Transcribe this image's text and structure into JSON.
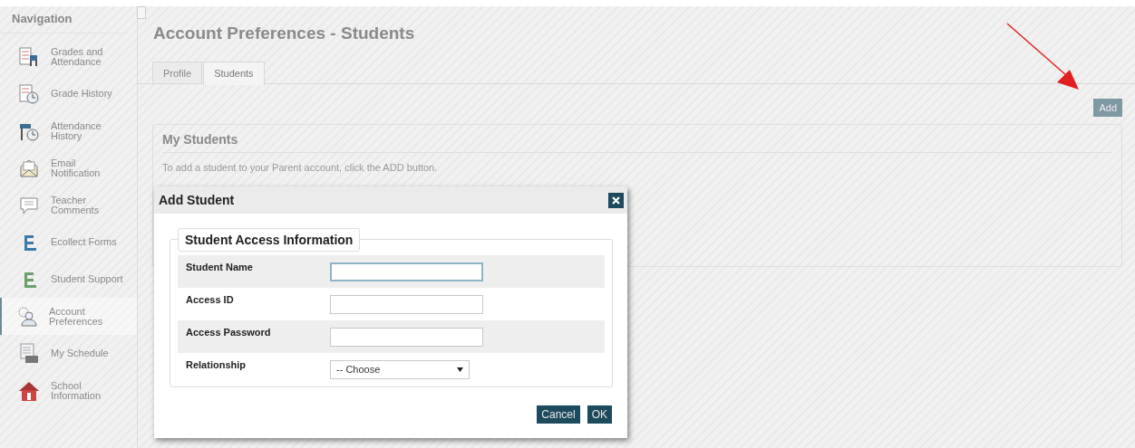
{
  "sidebar": {
    "title": "Navigation",
    "items": [
      {
        "label": "Grades and Attendance",
        "kind": "grades",
        "selected": false
      },
      {
        "label": "Grade History",
        "kind": "history",
        "selected": false
      },
      {
        "label": "Attendance History",
        "kind": "attendance",
        "selected": false
      },
      {
        "label": "Email Notification",
        "kind": "email",
        "selected": false
      },
      {
        "label": "Teacher Comments",
        "kind": "comments",
        "selected": false
      },
      {
        "label": "Ecollect Forms",
        "kind": "ecollect",
        "selected": false
      },
      {
        "label": "Student Support",
        "kind": "support",
        "selected": false
      },
      {
        "label": "Account Preferences",
        "kind": "account",
        "selected": true
      },
      {
        "label": "My Schedule",
        "kind": "schedule",
        "selected": false
      },
      {
        "label": "School Information",
        "kind": "school",
        "selected": false
      }
    ]
  },
  "page": {
    "title": "Account Preferences - Students",
    "tabs": [
      {
        "label": "Profile",
        "selected": false
      },
      {
        "label": "Students",
        "selected": true
      }
    ],
    "add_button": "Add",
    "panel": {
      "title": "My Students",
      "text": "To add a student to your Parent account, click the ADD button."
    }
  },
  "dialog": {
    "title": "Add Student",
    "legend": "Student Access Information",
    "fields": [
      {
        "label": "Student Name",
        "kind": "text",
        "focused": true
      },
      {
        "label": "Access ID",
        "kind": "text",
        "focused": false
      },
      {
        "label": "Access Password",
        "kind": "text",
        "focused": false
      },
      {
        "label": "Relationship",
        "kind": "select",
        "value": "-- Choose"
      }
    ],
    "buttons": [
      "Cancel",
      "OK"
    ]
  }
}
